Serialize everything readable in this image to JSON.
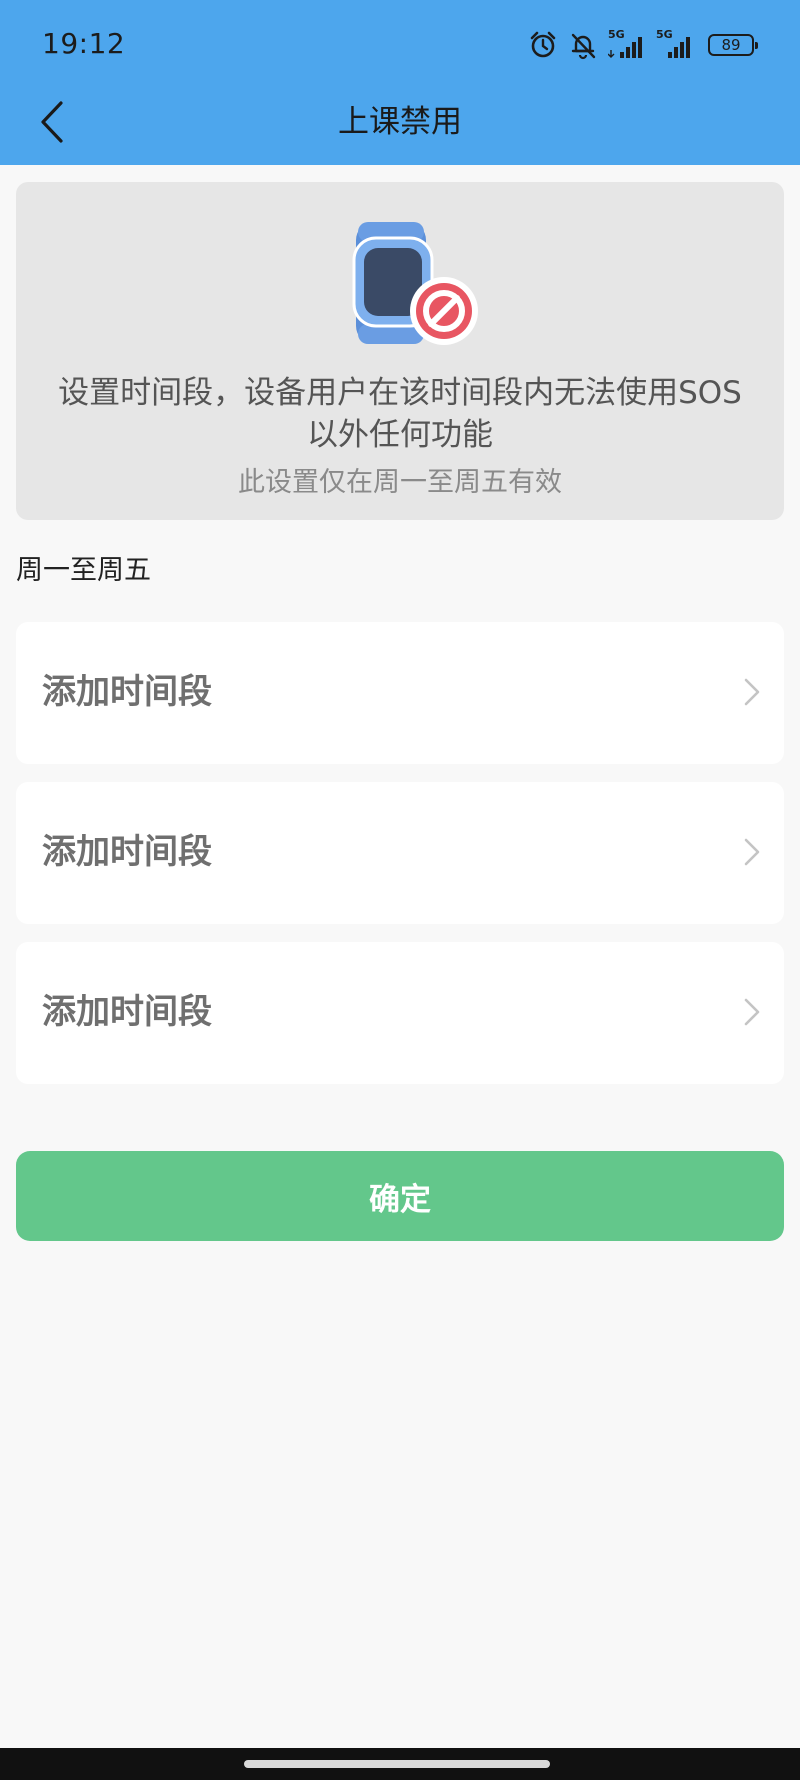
{
  "status_bar": {
    "time": "19:12",
    "net_label_1": "5G",
    "net_label_2": "5G",
    "battery": "89",
    "icons": [
      "alarm-icon",
      "bell-muted-icon",
      "signal-icon",
      "signal-icon",
      "battery-icon"
    ]
  },
  "header": {
    "title": "上课禁用",
    "back_icon": "chevron-left-icon",
    "color": "#4da6ed"
  },
  "info": {
    "main_text": "设置时间段，设备用户在该时间段内无法使用SOS以外任何功能",
    "sub_text": "此设置仅在周一至周五有效",
    "illustration": "watch-blocked-icon"
  },
  "section": {
    "label": "周一至周五"
  },
  "slots": [
    {
      "label": "添加时间段"
    },
    {
      "label": "添加时间段"
    },
    {
      "label": "添加时间段"
    }
  ],
  "confirm": {
    "label": "确定",
    "color": "#63c78b"
  }
}
